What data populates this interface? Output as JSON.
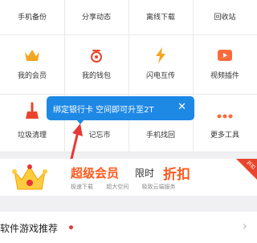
{
  "grid": {
    "row1": [
      "手机备份",
      "分享动态",
      "离线下载",
      "回收站"
    ],
    "row2": [
      "我的会员",
      "我的钱包",
      "闪电互传",
      "视频插件"
    ],
    "row3": [
      "垃圾清理",
      "记事本",
      "手机找回",
      "更多工具"
    ],
    "row3_visible": [
      "垃圾清理",
      "记忘市",
      "手机找回",
      "更多工具"
    ]
  },
  "tooltip": {
    "text": "绑定银行卡 空间即可升至2T",
    "close": "✕"
  },
  "banner": {
    "title": "超级会员",
    "limited": "限时",
    "discount": "折扣",
    "features": [
      "极速下载",
      "超大空间",
      "极致云端服务"
    ],
    "corner": "折扣"
  },
  "section": {
    "title": "软件游戏推荐",
    "chevron": "›"
  },
  "colors": {
    "accent_blue": "#1e88e5",
    "accent_orange": "#ff5a1f",
    "red": "#e53935"
  }
}
